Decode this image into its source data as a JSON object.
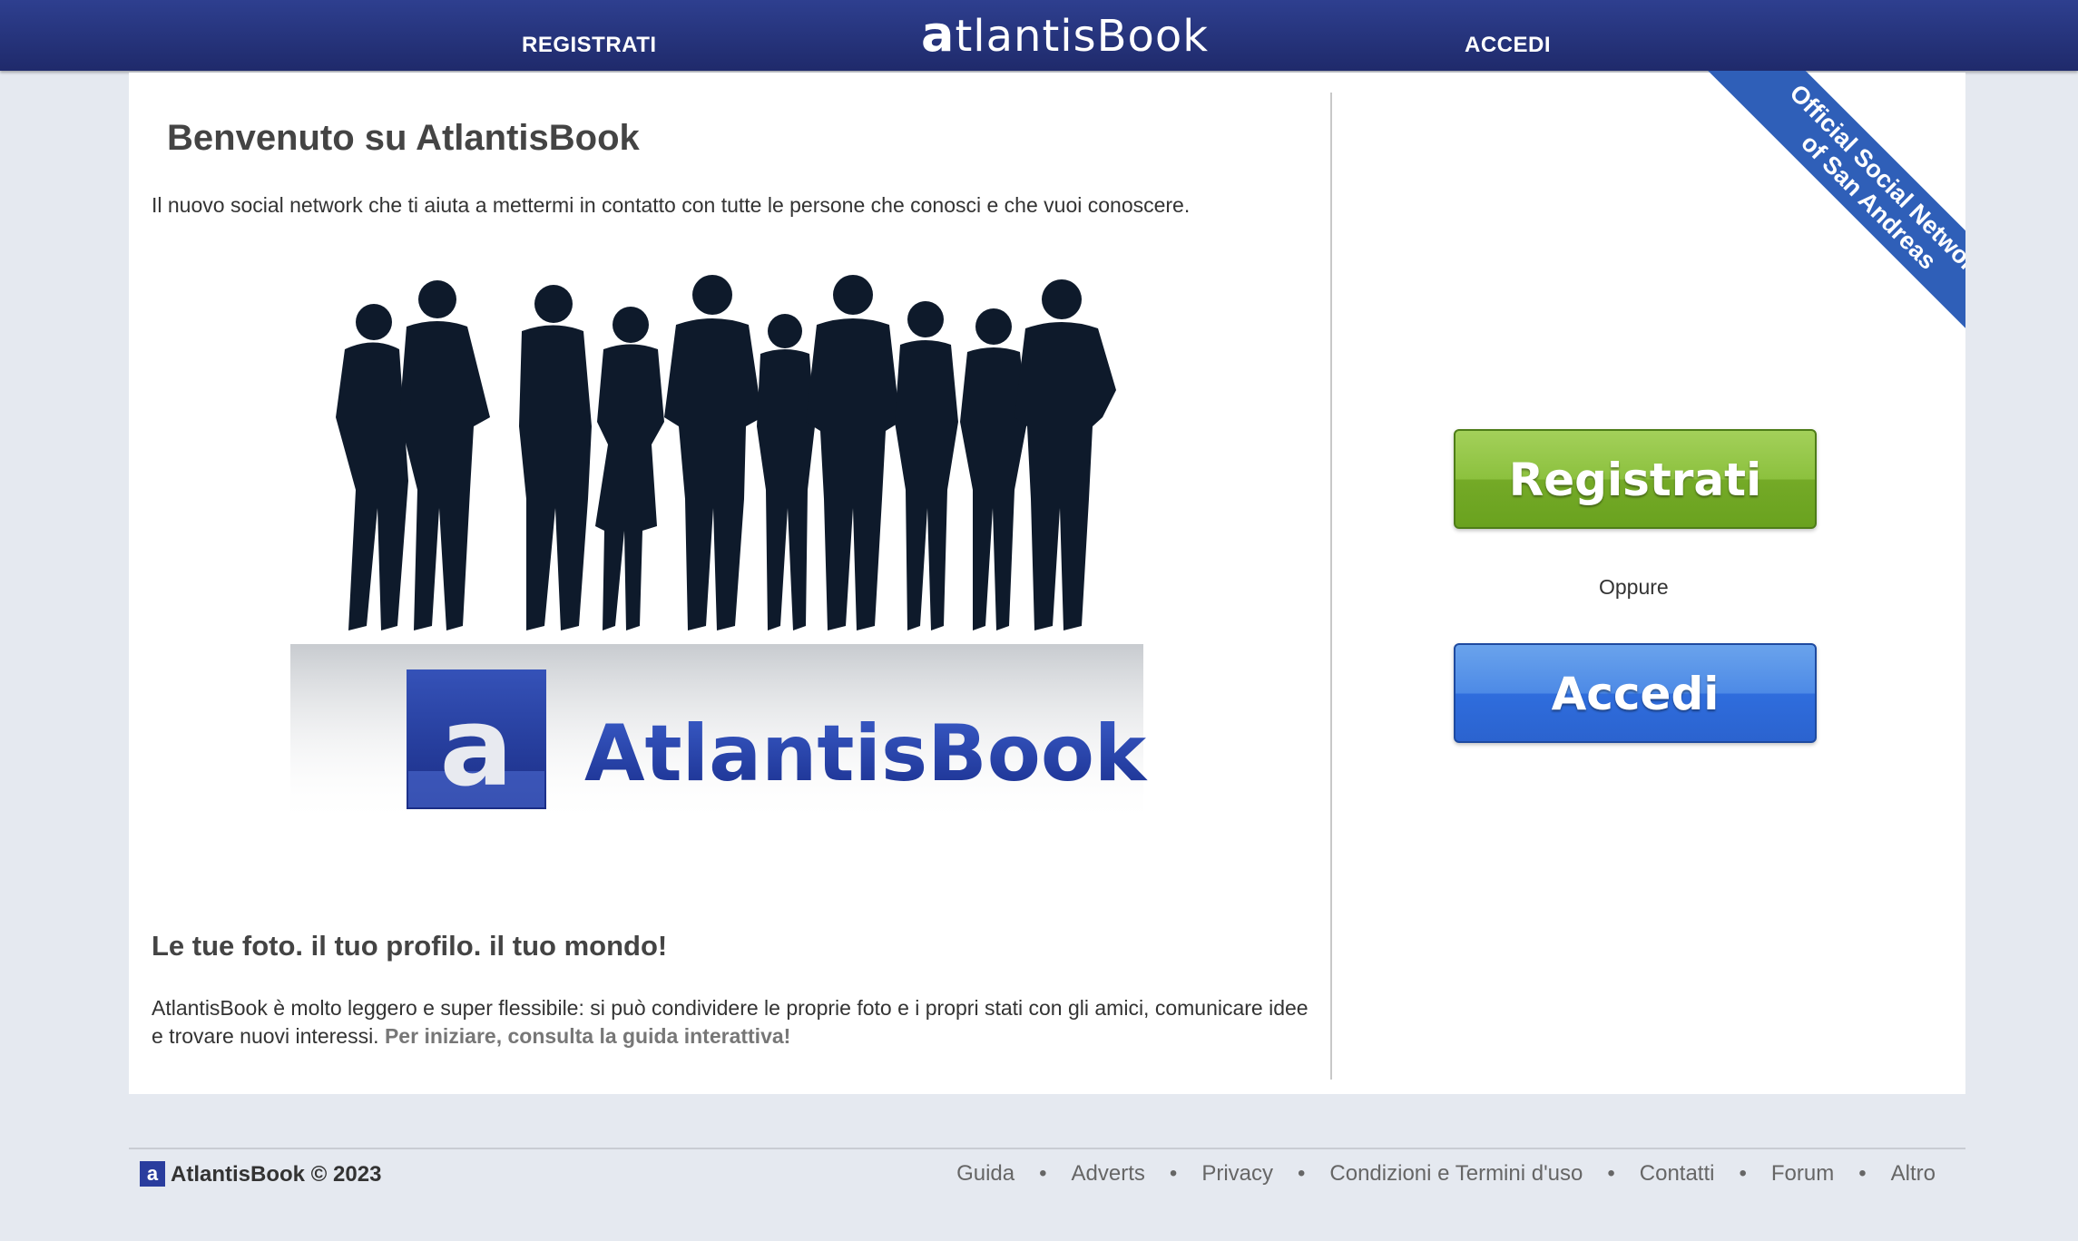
{
  "topbar": {
    "register_label": "REGISTRATI",
    "login_label": "ACCEDI",
    "logo_letter": "a",
    "logo_text": "tlantisBook"
  },
  "main": {
    "welcome_title": "Benvenuto su AtlantisBook",
    "welcome_sub": "Il nuovo social network che ti aiuta a mettermi in contatto con tutte le persone che conosci e che vuoi conoscere.",
    "hero_brand": "AtlantisBook",
    "hero_brand_letter": "a",
    "tagline": "Le tue foto. il tuo profilo. il tuo mondo!",
    "desc_text": "AtlantisBook è molto leggero e super flessibile: si può condividere le proprie foto e i propri stati con gli amici, comunicare idee e trovare nuovi interessi.",
    "desc_link": "Per iniziare, consulta la guida interattiva!"
  },
  "side": {
    "ribbon_line1": "Official Social Network",
    "ribbon_line2": "of San Andreas",
    "register_button": "Registrati",
    "or_text": "Oppure",
    "login_button": "Accedi"
  },
  "footer": {
    "logo_letter": "a",
    "copyright": "AtlantisBook © 2023",
    "links": [
      "Guida",
      "Adverts",
      "Privacy",
      "Condizioni e Termini d'uso",
      "Contatti",
      "Forum",
      "Altro"
    ],
    "separator": "•"
  },
  "colors": {
    "topbar": "#2a378a",
    "register_green": "#7ab52e",
    "login_blue": "#3a76e0",
    "ribbon_blue": "#2f5fb8",
    "silhouette": "#0e1a2b"
  }
}
